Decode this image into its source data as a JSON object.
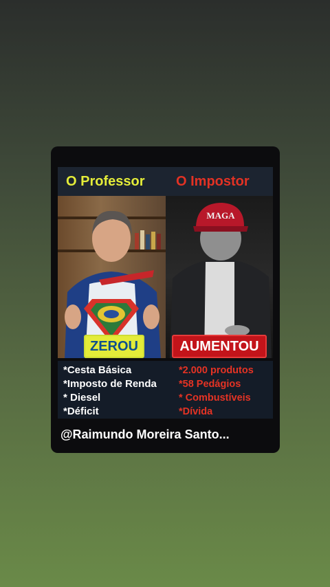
{
  "post": {
    "header": {
      "left_title": "O Professor",
      "right_title": "O Impostor"
    },
    "photos": {
      "left_badge": "ZEROU",
      "right_badge": "AUMENTOU",
      "cap_text": "MAGA"
    },
    "left_items": [
      "*Cesta Básica",
      "*Imposto de Renda",
      "* Diesel",
      "*Déficit"
    ],
    "right_items": [
      "*2.000 produtos",
      "*58 Pedágios",
      "* Combustíveis",
      "*Dívida"
    ],
    "footer": "@Raimundo Moreira Santo..."
  },
  "colors": {
    "yellow_accent": "#e4ec39",
    "red_accent": "#e23224",
    "header_bg": "#1c2430",
    "card_bg": "#0c0c0e"
  }
}
